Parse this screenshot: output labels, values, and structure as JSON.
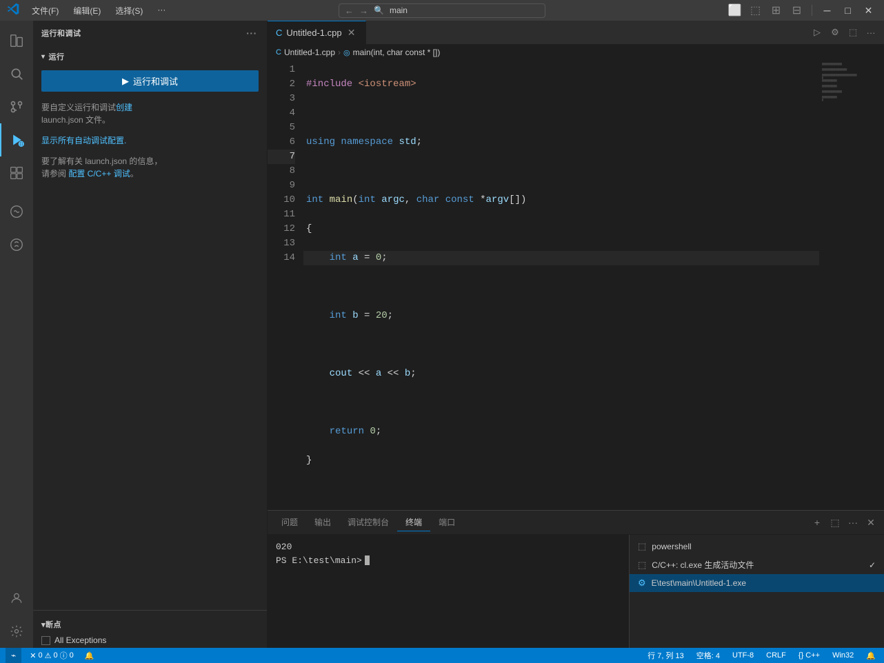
{
  "titlebar": {
    "logo": "✦",
    "menus": [
      "文件(F)",
      "编辑(E)",
      "选择(S)",
      "···"
    ],
    "search_placeholder": "main",
    "back_btn": "←",
    "forward_btn": "→",
    "window_btns": {
      "sidebar_icon": "▣",
      "zen_icon": "⬜",
      "split_icon": "⬚",
      "layout_icon": "⊞",
      "minimize": "─",
      "maximize": "□",
      "close": "✕"
    }
  },
  "activity_bar": {
    "icons": [
      {
        "name": "explorer",
        "symbol": "⎘",
        "active": false
      },
      {
        "name": "search",
        "symbol": "🔍",
        "active": false
      },
      {
        "name": "source-control",
        "symbol": "⑂",
        "active": false
      },
      {
        "name": "run-debug",
        "symbol": "▶",
        "active": true
      },
      {
        "name": "extensions",
        "symbol": "⊞",
        "active": false
      },
      {
        "name": "copilot1",
        "symbol": "◎",
        "active": false
      },
      {
        "name": "copilot2",
        "symbol": "◎",
        "active": false
      },
      {
        "name": "accounts",
        "symbol": "👤",
        "active": false
      },
      {
        "name": "settings",
        "symbol": "⚙",
        "active": false
      }
    ]
  },
  "sidebar": {
    "title": "运行和调试",
    "more_icon": "···",
    "run_section": {
      "label": "运行",
      "button_label": "运行和调试",
      "button_icon": "▶"
    },
    "info_text1_before": "要自定义运行和调试",
    "info_link1": "创建",
    "info_text1_after": "",
    "info_text1_line2": "launch.json 文件。",
    "info_link2": "显示所有自动调试配置.",
    "info_text2_before": "要了解有关 launch.json 的信息，",
    "info_text2_line2_before": "请参阅 ",
    "info_link3": "配置 C/C++ 调试",
    "info_text2_line2_after": "。",
    "breakpoints": {
      "title": "断点",
      "items": [
        {
          "label": "All Exceptions",
          "checked": false
        }
      ]
    }
  },
  "editor": {
    "tab_label": "Untitled-1.cpp",
    "tab_icon": "C",
    "breadcrumb": {
      "file": "Untitled-1.cpp",
      "symbol": "main(int, char const * [])"
    },
    "lines": [
      {
        "num": 1,
        "content": "#include <iostream>",
        "type": "include"
      },
      {
        "num": 2,
        "content": "",
        "type": "blank"
      },
      {
        "num": 3,
        "content": "using namespace std;",
        "type": "using"
      },
      {
        "num": 4,
        "content": "",
        "type": "blank"
      },
      {
        "num": 5,
        "content": "int main(int argc, char const *argv[])",
        "type": "funcdef"
      },
      {
        "num": 6,
        "content": "{",
        "type": "brace"
      },
      {
        "num": 7,
        "content": "    int a = 0;",
        "type": "stmt",
        "active": true
      },
      {
        "num": 8,
        "content": "",
        "type": "blank"
      },
      {
        "num": 9,
        "content": "    int b = 20;",
        "type": "stmt"
      },
      {
        "num": 10,
        "content": "",
        "type": "blank"
      },
      {
        "num": 11,
        "content": "    cout << a << b;",
        "type": "stmt"
      },
      {
        "num": 12,
        "content": "",
        "type": "blank"
      },
      {
        "num": 13,
        "content": "    return 0;",
        "type": "return"
      },
      {
        "num": 14,
        "content": "}",
        "type": "brace"
      }
    ]
  },
  "terminal": {
    "tabs": [
      {
        "label": "问题",
        "active": false
      },
      {
        "label": "输出",
        "active": false
      },
      {
        "label": "调试控制台",
        "active": false
      },
      {
        "label": "终端",
        "active": true
      },
      {
        "label": "端口",
        "active": false
      }
    ],
    "add_btn": "+",
    "split_btn": "⬚",
    "more_btn": "···",
    "close_btn": "✕",
    "output_line1": "020",
    "prompt": "PS E:\\test\\main> ",
    "terminal_list": [
      {
        "label": "powershell",
        "icon": "⬚",
        "active": false,
        "check": false
      },
      {
        "label": "C/C++: cl.exe 生成活动文件",
        "icon": "⬚",
        "active": false,
        "check": true
      },
      {
        "label": "E\\test\\main\\Untitled-1.exe",
        "icon": "⚙",
        "active": true,
        "check": false
      }
    ]
  },
  "status_bar": {
    "remote_icon": "⌁",
    "remote_label": "",
    "error_icon": "✕",
    "error_count": "0",
    "warn_icon": "⚠",
    "warn_count": "0",
    "info_icon": "ⓘ",
    "info_count": "0",
    "line_col": "行 7, 列 13",
    "spaces": "空格: 4",
    "encoding": "UTF-8",
    "eol": "CRLF",
    "language": "{} C++",
    "os": "Win32",
    "bell_icon": "🔔"
  }
}
